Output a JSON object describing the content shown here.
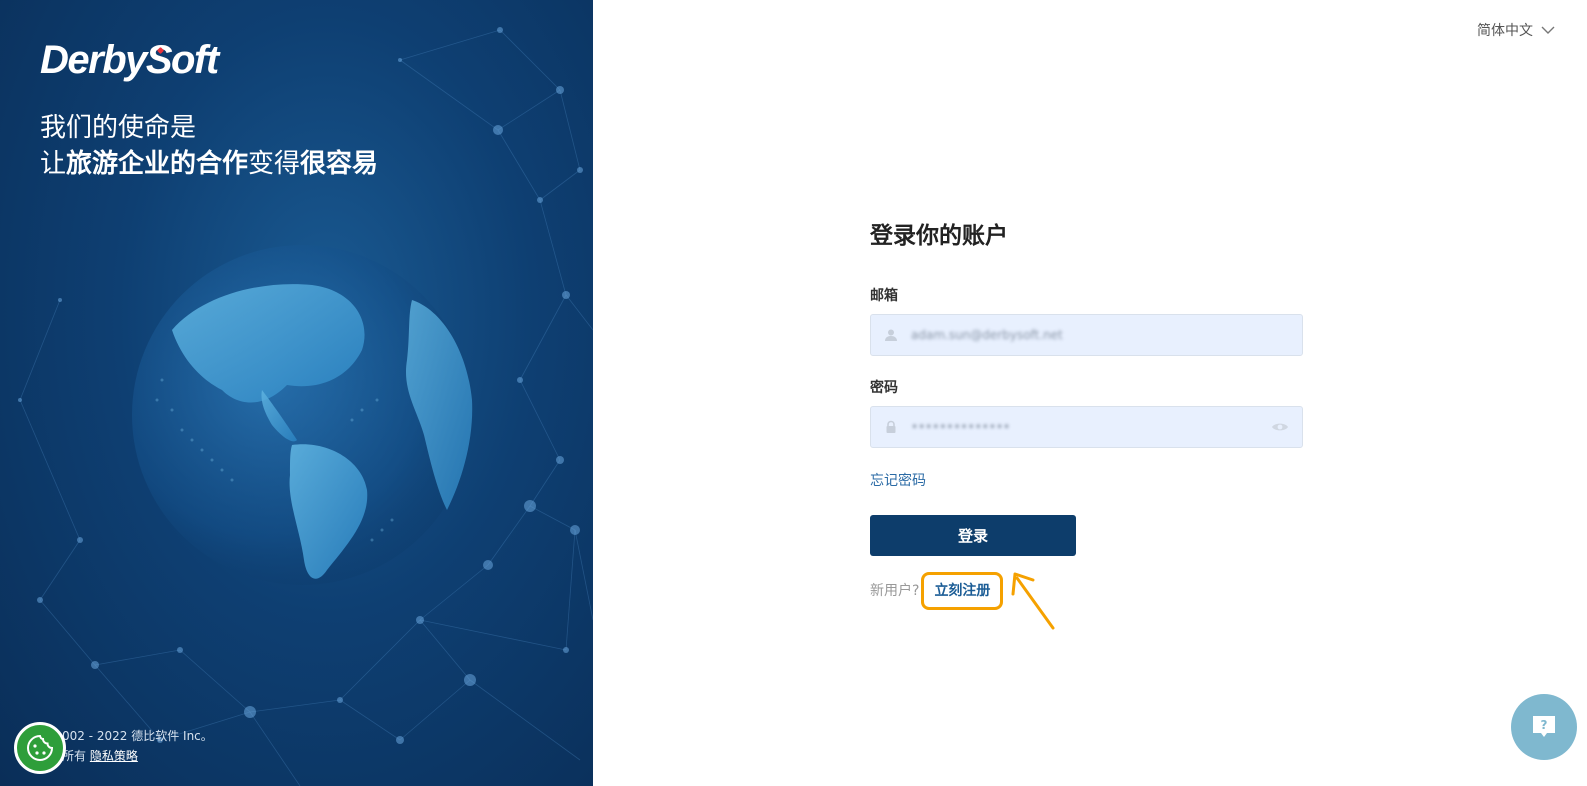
{
  "brand": {
    "logo_text": "DerbySoft",
    "accent_dot_color": "#e8323c"
  },
  "mission": {
    "line1": "我们的使命是",
    "line2_prefix": "让",
    "line2_bold1": "旅游企业的合作",
    "line2_mid": "变得",
    "line2_bold2": "很容易"
  },
  "footer": {
    "copyright": "002 - 2022 德比软件 Inc。",
    "rights_prefix": "所有",
    "privacy_label": "隐私策略"
  },
  "header": {
    "language": "简体中文"
  },
  "login": {
    "title": "登录你的账户",
    "email_label": "邮箱",
    "email_value": "adam.sun@derbysoft.net",
    "password_label": "密码",
    "password_value": "••••••••••••••",
    "forgot_password": "忘记密码",
    "login_button": "登录",
    "new_user_prompt": "新用户?",
    "register_link": "立刻注册"
  },
  "colors": {
    "primary": "#0d3d6b",
    "link": "#2a6aa5",
    "highlight": "#f5a100",
    "input_bg": "#e8f0fe",
    "help_bg": "#7fb8cf",
    "cookie_bg": "#2e9e3a"
  },
  "icons": {
    "email_prefix": "user-icon",
    "password_prefix": "lock-icon",
    "password_suffix": "eye-icon",
    "lang_dropdown": "chevron-down-icon",
    "help": "help-chat-icon",
    "cookie": "cookie-icon"
  }
}
